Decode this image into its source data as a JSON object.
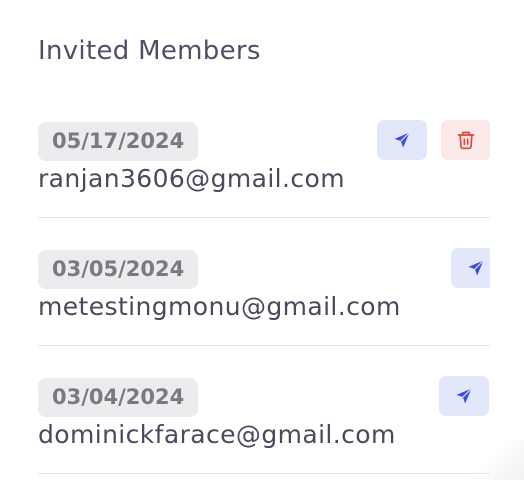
{
  "section": {
    "title": "Invited Members"
  },
  "members": [
    {
      "date": "05/17/2024",
      "email": "ranjan3606@gmail.com",
      "resend_icon": "send-icon",
      "delete_icon": "trash-icon",
      "has_delete": true
    },
    {
      "date": "03/05/2024",
      "email": "metestingmonu@gmail.com",
      "resend_icon": "send-icon",
      "has_delete": false
    },
    {
      "date": "03/04/2024",
      "email": "dominickfarace@gmail.com",
      "resend_icon": "send-icon",
      "has_delete": false
    }
  ],
  "colors": {
    "resend_bg": "#e2e7fa",
    "resend_icon": "#3b4fd8",
    "delete_bg": "#fbe9e9",
    "delete_icon": "#e0443e",
    "badge_bg": "#ececee",
    "badge_text": "#7a7a7f",
    "title_text": "#4f4f6a"
  }
}
